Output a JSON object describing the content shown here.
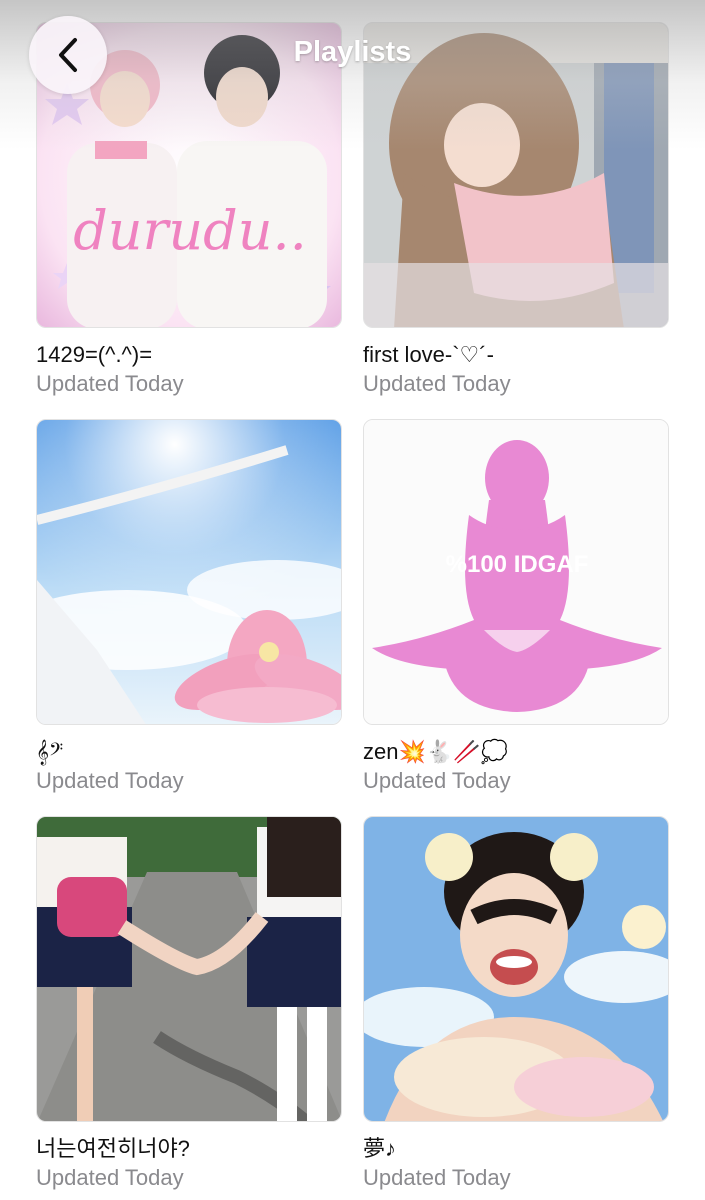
{
  "header": {
    "title": "Playlists",
    "back_icon": "chevron-left-icon"
  },
  "playlists": [
    {
      "name": "1429=(^.^)=",
      "updated": "Updated Today",
      "art_text": "durudu.."
    },
    {
      "name": "first love-`♡´-",
      "updated": "Updated Today"
    },
    {
      "name": "𝄞𝄢",
      "updated": "Updated Today"
    },
    {
      "name": "zen💥🐇🥢💭",
      "updated": "Updated Today",
      "art_text": "%100 IDGAF"
    },
    {
      "name": "너는여전히너야?",
      "updated": "Updated Today"
    },
    {
      "name": "夢♪",
      "updated": "Updated Today"
    }
  ],
  "colors": {
    "title_text": "#ffffff",
    "subtitle_gray": "#8a8a8e",
    "name_text": "#111111"
  }
}
